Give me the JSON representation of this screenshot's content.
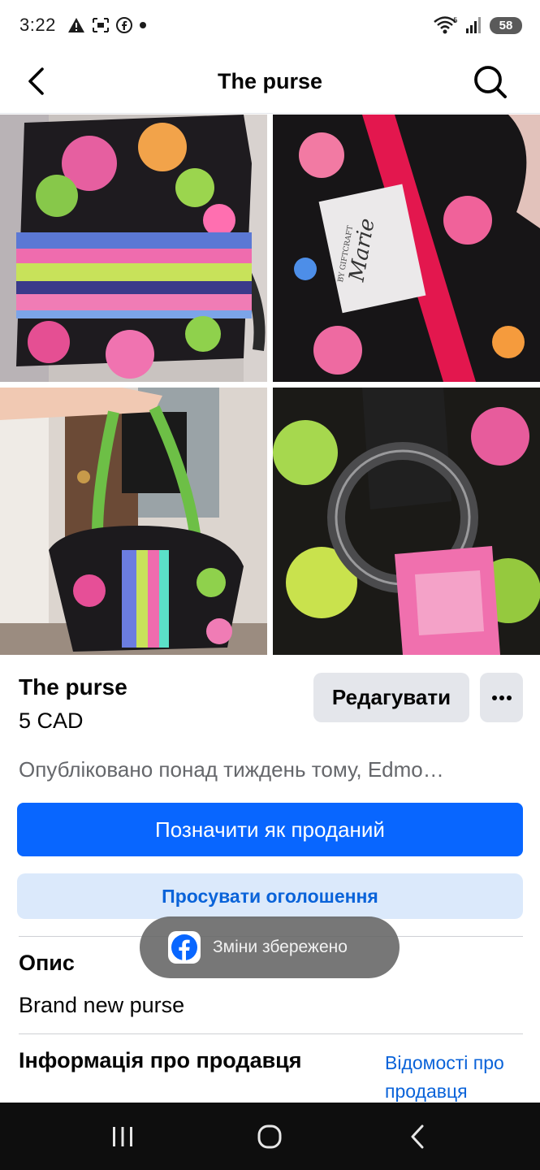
{
  "status": {
    "time": "3:22",
    "battery": "58"
  },
  "header": {
    "title": "The purse"
  },
  "photos": [
    {
      "alt": "Floral quilted purse, front view"
    },
    {
      "alt": "Marie by Giftcraft label inside purse"
    },
    {
      "alt": "Hand holding floral purse by straps"
    },
    {
      "alt": "Close-up of metal ring on purse strap"
    }
  ],
  "listing": {
    "title": "The purse",
    "price": "5 CAD",
    "edit_label": "Редагувати",
    "more_label": "•••",
    "published": "Опубліковано понад тиждень тому, Edmo…",
    "mark_sold_label": "Позначити як проданий",
    "promote_label": "Просувати оголошення"
  },
  "description": {
    "heading": "Опис",
    "text": "Brand new purse"
  },
  "seller": {
    "heading": "Інформація про продавця",
    "link_label": "Відомості про продавця"
  },
  "toast": {
    "text": "Зміни збережено"
  },
  "label_text": {
    "line1": "Marie",
    "line2": "BY GIFTCRAFT"
  },
  "colors": {
    "accent": "#0866ff",
    "promote_bg": "#dbe9fb",
    "link": "#0a63d9",
    "button_gray": "#e4e6eb"
  }
}
